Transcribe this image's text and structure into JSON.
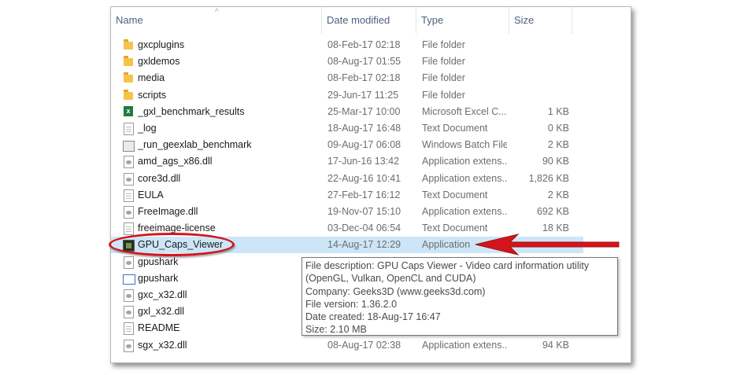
{
  "columns": {
    "name": "Name",
    "date": "Date modified",
    "type": "Type",
    "size": "Size"
  },
  "files": [
    {
      "name": "gxcplugins",
      "date": "08-Feb-17 02:18",
      "type": "File folder",
      "size": "",
      "icon": "folder-icon"
    },
    {
      "name": "gxldemos",
      "date": "08-Aug-17 01:55",
      "type": "File folder",
      "size": "",
      "icon": "folder-icon"
    },
    {
      "name": "media",
      "date": "08-Feb-17 02:18",
      "type": "File folder",
      "size": "",
      "icon": "folder-icon"
    },
    {
      "name": "scripts",
      "date": "29-Jun-17 11:25",
      "type": "File folder",
      "size": "",
      "icon": "folder-icon"
    },
    {
      "name": "_gxl_benchmark_results",
      "date": "25-Mar-17 10:00",
      "type": "Microsoft Excel C...",
      "size": "1 KB",
      "icon": "excel-icon"
    },
    {
      "name": "_log",
      "date": "18-Aug-17 16:48",
      "type": "Text Document",
      "size": "0 KB",
      "icon": "text-document-icon"
    },
    {
      "name": "_run_geexlab_benchmark",
      "date": "09-Aug-17 06:08",
      "type": "Windows Batch File",
      "size": "2 KB",
      "icon": "batch-file-icon"
    },
    {
      "name": "amd_ags_x86.dll",
      "date": "17-Jun-16 13:42",
      "type": "Application extens...",
      "size": "90 KB",
      "icon": "dll-icon"
    },
    {
      "name": "core3d.dll",
      "date": "22-Aug-16 10:41",
      "type": "Application extens...",
      "size": "1,826 KB",
      "icon": "dll-icon"
    },
    {
      "name": "EULA",
      "date": "27-Feb-17 16:12",
      "type": "Text Document",
      "size": "2 KB",
      "icon": "text-document-icon"
    },
    {
      "name": "FreeImage.dll",
      "date": "19-Nov-07 15:10",
      "type": "Application extens...",
      "size": "692 KB",
      "icon": "dll-icon"
    },
    {
      "name": "freeimage-license",
      "date": "03-Dec-04 06:54",
      "type": "Text Document",
      "size": "18 KB",
      "icon": "text-document-icon"
    },
    {
      "name": "GPU_Caps_Viewer",
      "date": "14-Aug-17 12:29",
      "type": "Application",
      "size": "",
      "icon": "application-icon",
      "selected": true
    },
    {
      "name": "gpushark",
      "date": "",
      "type": "",
      "size": "",
      "icon": "dll-icon"
    },
    {
      "name": "gpushark",
      "date": "",
      "type": "",
      "size": "",
      "icon": "window-icon"
    },
    {
      "name": "gxc_x32.dll",
      "date": "",
      "type": "",
      "size": "",
      "icon": "dll-icon"
    },
    {
      "name": "gxl_x32.dll",
      "date": "",
      "type": "",
      "size": "",
      "icon": "dll-icon"
    },
    {
      "name": "README",
      "date": "",
      "type": "",
      "size": "",
      "icon": "text-document-icon"
    },
    {
      "name": "sgx_x32.dll",
      "date": "08-Aug-17 02:38",
      "type": "Application extens...",
      "size": "94 KB",
      "icon": "dll-icon"
    }
  ],
  "tooltip": {
    "description": "File description: GPU Caps Viewer - Video card information utility (OpenGL, Vulkan, OpenCL and CUDA)",
    "company": "Company: Geeks3D (www.geeks3d.com)",
    "version": "File version: 1.36.2.0",
    "created": "Date created: 18-Aug-17 16:47",
    "size": "Size: 2.10 MB"
  },
  "colors": {
    "selection": "#cde6f7",
    "annotation_red": "#d4141a",
    "header_text": "#4d6082"
  }
}
